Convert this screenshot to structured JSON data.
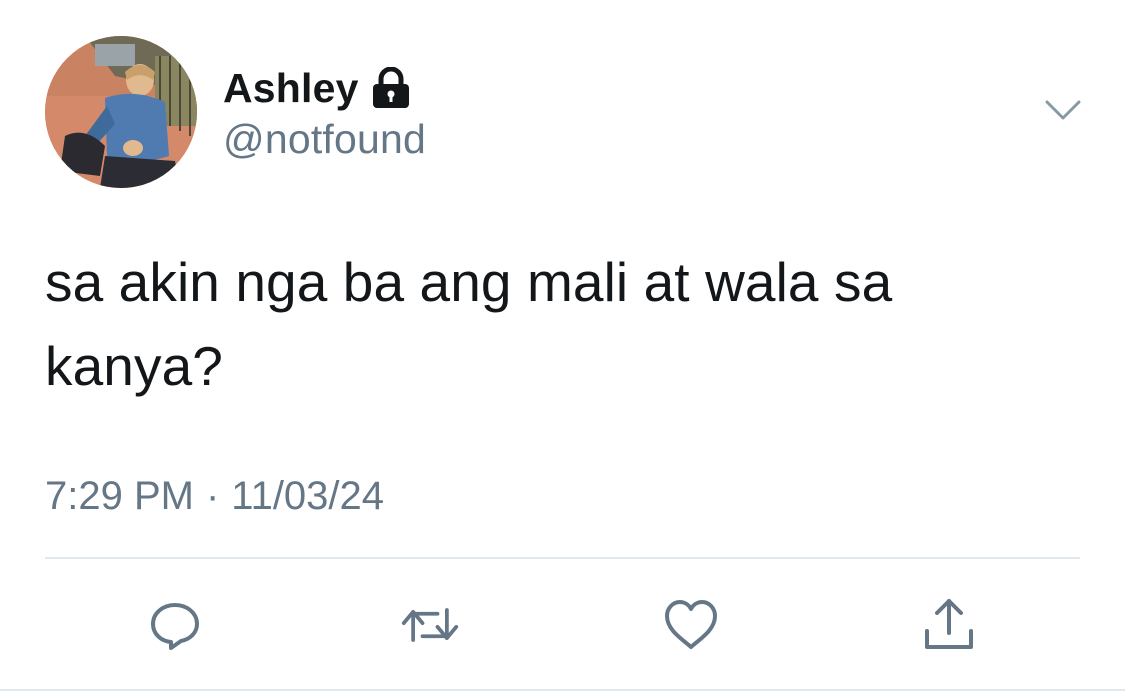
{
  "author": {
    "display_name": "Ashley",
    "handle": "@notfound",
    "protected_icon": "lock-icon",
    "avatar": "profile-photo"
  },
  "menu_icon": "chevron-down-icon",
  "tweet": {
    "text_line1": "sa akin nga ba ang mali at wala sa",
    "text_line2": "kanya?",
    "time": "7:29 PM",
    "separator": "·",
    "date": "11/03/24"
  },
  "actions": [
    {
      "name": "reply",
      "icon": "reply-icon"
    },
    {
      "name": "retweet",
      "icon": "retweet-icon"
    },
    {
      "name": "like",
      "icon": "heart-icon"
    },
    {
      "name": "share",
      "icon": "share-icon"
    }
  ],
  "colors": {
    "text": "#14171a",
    "secondary": "#657786",
    "divider": "#e1e8ed",
    "icon": "#657786"
  }
}
